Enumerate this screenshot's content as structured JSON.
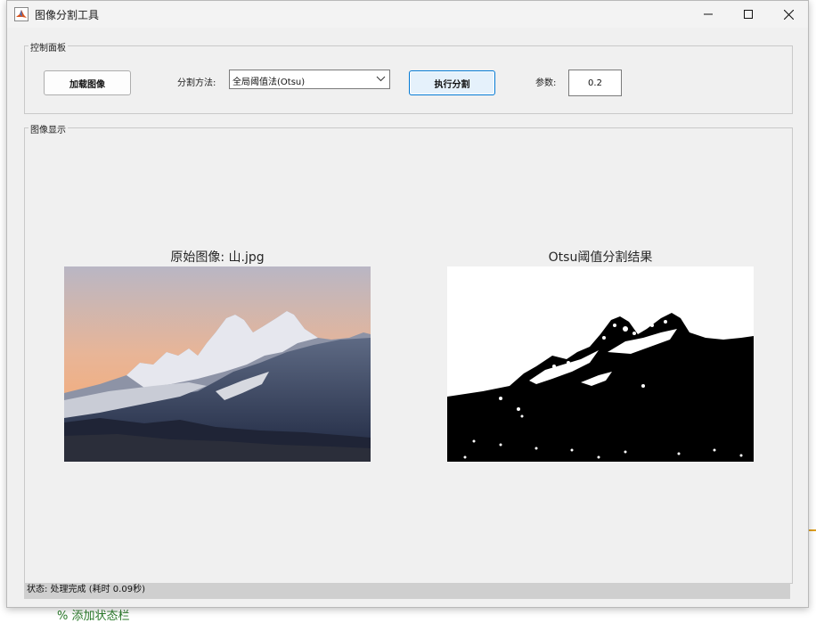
{
  "window": {
    "title": "图像分割工具"
  },
  "control_panel": {
    "legend": "控制面板",
    "load_button": "加载图像",
    "method_label": "分割方法:",
    "method_value": "全局阈值法(Otsu)",
    "run_button": "执行分割",
    "param_label": "参数:",
    "param_value": "0.2"
  },
  "display_panel": {
    "legend": "图像显示",
    "original_title": "原始图像: 山.jpg",
    "result_title": "Otsu阈值分割结果"
  },
  "status": {
    "text": "状态: 处理完成 (耗时 0.09秒)"
  },
  "background": {
    "peek_text": "% 添加状态栏"
  },
  "icons": {
    "app": "matlab-icon",
    "minimize": "minimize-icon",
    "maximize": "maximize-icon",
    "close": "close-icon",
    "dropdown": "chevron-down-icon"
  },
  "colors": {
    "accent": "#0078d4",
    "window_bg": "#f0f0f0",
    "statusbar_bg": "#cfcfcf"
  }
}
